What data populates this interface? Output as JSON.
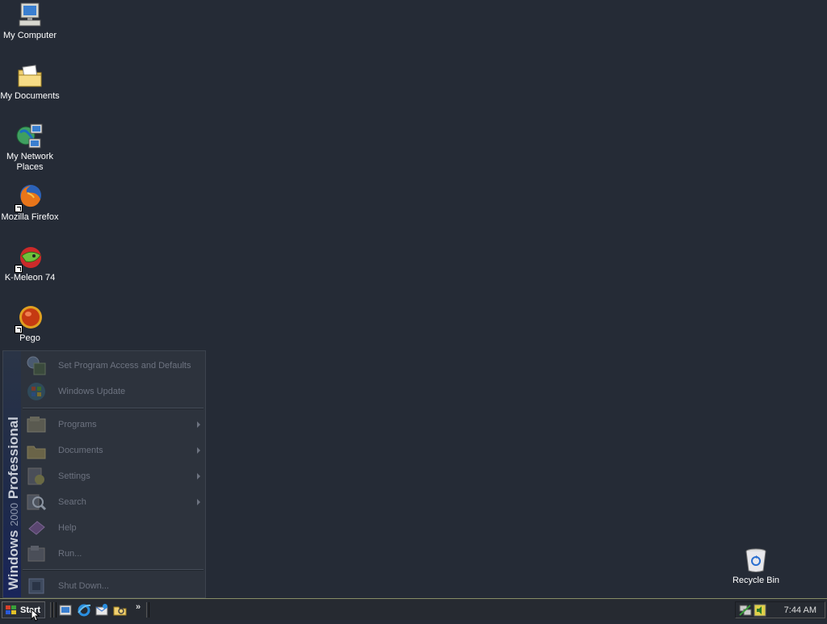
{
  "desktop": {
    "icons": [
      {
        "label": "My Computer",
        "icon": "my-computer-icon"
      },
      {
        "label": "My Documents",
        "icon": "my-documents-icon"
      },
      {
        "label": "My Network Places",
        "icon": "network-places-icon"
      },
      {
        "label": "Mozilla Firefox",
        "icon": "firefox-icon"
      },
      {
        "label": "K-Meleon 74",
        "icon": "k-meleon-icon"
      },
      {
        "label": "Pego",
        "icon": "pego-icon"
      }
    ],
    "recycle_bin": {
      "label": "Recycle Bin",
      "icon": "recycle-bin-icon"
    }
  },
  "start_menu": {
    "banner_bold": "Windows",
    "banner_thin": "2000",
    "banner_bold2": "Professional",
    "items": [
      {
        "label": "Set Program Access and Defaults",
        "icon": "program-access-icon",
        "submenu": false
      },
      {
        "label": "Windows Update",
        "icon": "windows-update-icon",
        "submenu": false
      },
      {
        "label": "Programs",
        "icon": "programs-icon",
        "submenu": true
      },
      {
        "label": "Documents",
        "icon": "documents-icon",
        "submenu": true
      },
      {
        "label": "Settings",
        "icon": "settings-icon",
        "submenu": true
      },
      {
        "label": "Search",
        "icon": "search-icon",
        "submenu": true
      },
      {
        "label": "Help",
        "icon": "help-icon",
        "submenu": false
      },
      {
        "label": "Run...",
        "icon": "run-icon",
        "submenu": false
      },
      {
        "label": "Shut Down...",
        "icon": "shut-down-icon",
        "submenu": false
      }
    ]
  },
  "taskbar": {
    "start_label": "Start",
    "quick_launch_more": "»",
    "clock": "7:44 AM"
  },
  "colors": {
    "desktop_background": "#252b36",
    "menu_background": "#2d333d",
    "menu_text": "#6d7380",
    "taskbar_background": "#262a31"
  }
}
